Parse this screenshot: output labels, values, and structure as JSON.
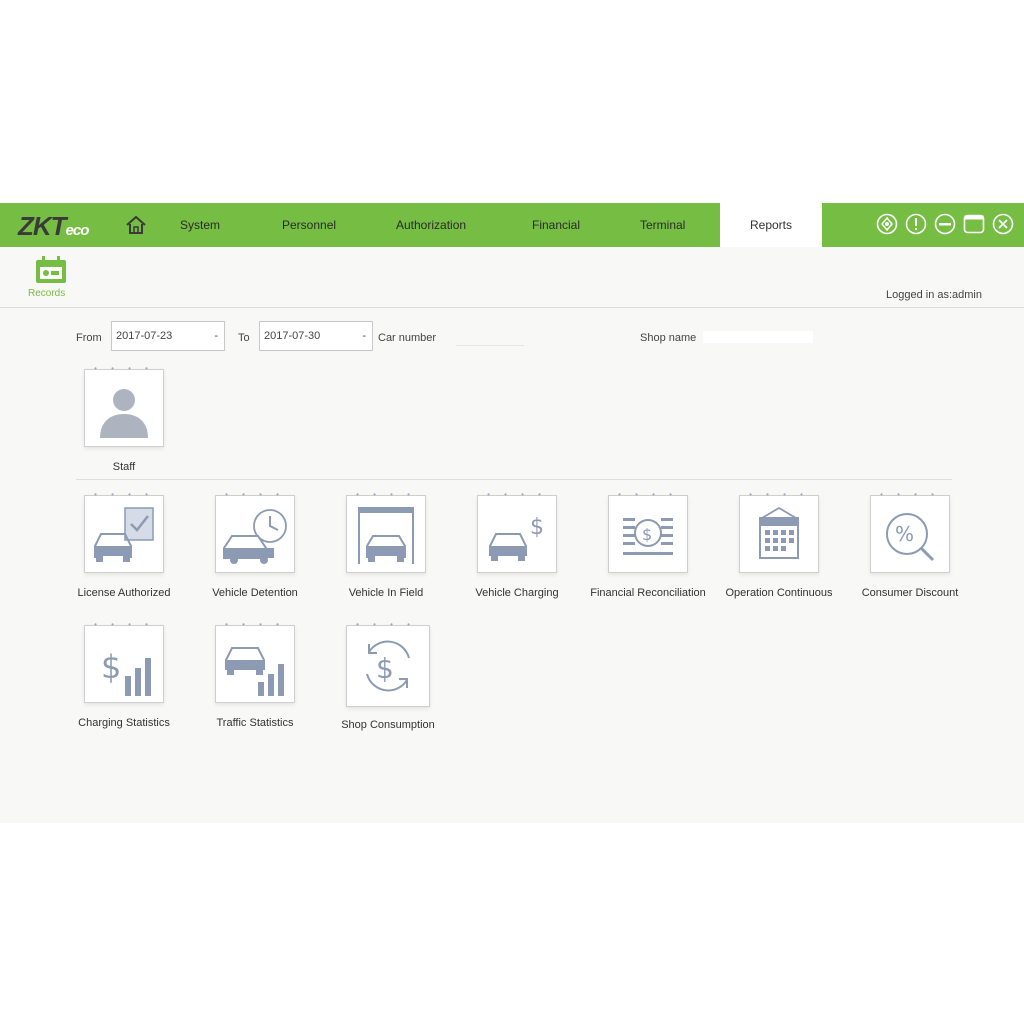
{
  "brand": {
    "logo_main": "ZKT",
    "logo_sub": "eco"
  },
  "nav": {
    "items": [
      {
        "label": "System"
      },
      {
        "label": "Personnel"
      },
      {
        "label": "Authorization"
      },
      {
        "label": "Financial"
      },
      {
        "label": "Terminal"
      },
      {
        "label": "Reports"
      }
    ],
    "active": "Reports"
  },
  "subnav": {
    "label": "Records"
  },
  "status": {
    "logged_in": "Logged in as:admin"
  },
  "filters": {
    "from_label": "From",
    "from_value": "2017-07-23",
    "to_label": "To",
    "to_value": "2017-07-30",
    "car_number_label": "Car number",
    "shop_name_label": "Shop name"
  },
  "tiles_row1": [
    {
      "label": "Staff",
      "icon": "person-icon"
    }
  ],
  "tiles_row2": [
    {
      "label": "License Authorized",
      "icon": "car-check-icon"
    },
    {
      "label": "Vehicle Detention",
      "icon": "car-clock-icon"
    },
    {
      "label": "Vehicle In Field",
      "icon": "car-garage-icon"
    },
    {
      "label": "Vehicle Charging",
      "icon": "car-dollar-icon"
    },
    {
      "label": "Financial Reconciliation",
      "icon": "coin-document-icon"
    },
    {
      "label": "Operation Continuous",
      "icon": "calendar-icon"
    },
    {
      "label": "Consumer Discount",
      "icon": "percent-search-icon"
    }
  ],
  "tiles_row3": [
    {
      "label": "Charging Statistics",
      "icon": "dollar-bars-icon"
    },
    {
      "label": "Traffic Statistics",
      "icon": "car-bars-icon"
    },
    {
      "label": "Shop Consumption",
      "icon": "dollar-cycle-icon"
    }
  ],
  "colors": {
    "accent": "#76bd43",
    "icon_stroke": "#8c9ab3"
  }
}
